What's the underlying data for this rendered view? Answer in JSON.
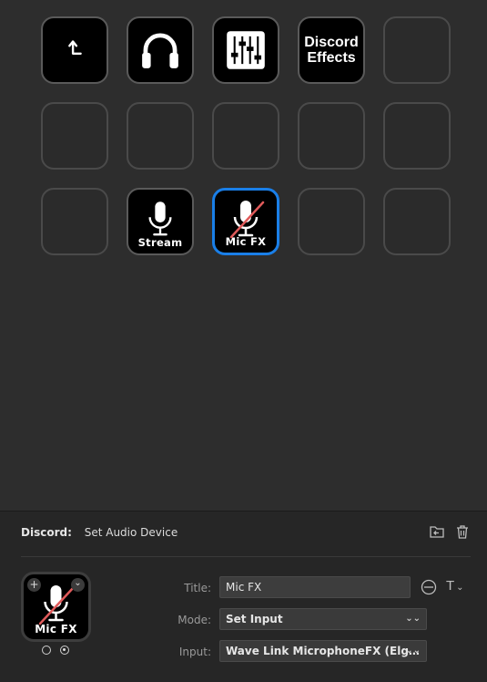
{
  "grid": {
    "keys": [
      {
        "id": "r1c1",
        "type": "back",
        "icon": "back-arrow-icon",
        "label": ""
      },
      {
        "id": "r1c2",
        "type": "icon",
        "icon": "headphones-icon",
        "label": ""
      },
      {
        "id": "r1c3",
        "type": "icon",
        "icon": "mixer-sliders-icon",
        "label": ""
      },
      {
        "id": "r1c4",
        "type": "text",
        "text_line1": "Discord",
        "text_line2": "Effects"
      },
      {
        "id": "r1c5",
        "type": "empty"
      },
      {
        "id": "r2c1",
        "type": "empty"
      },
      {
        "id": "r2c2",
        "type": "empty"
      },
      {
        "id": "r2c3",
        "type": "empty"
      },
      {
        "id": "r2c4",
        "type": "empty"
      },
      {
        "id": "r2c5",
        "type": "empty"
      },
      {
        "id": "r3c1",
        "type": "empty"
      },
      {
        "id": "r3c2",
        "type": "icon",
        "icon": "microphone-icon",
        "label": "Stream"
      },
      {
        "id": "r3c3",
        "type": "icon",
        "icon": "microphone-muted-icon",
        "label": "Mic FX",
        "selected": true
      },
      {
        "id": "r3c4",
        "type": "empty"
      },
      {
        "id": "r3c5",
        "type": "empty"
      }
    ]
  },
  "panel": {
    "plugin_name": "Discord:",
    "action_name": "Set Audio Device",
    "preview_label": "Mic FX",
    "title_label": "Title:",
    "title_value": "Mic FX",
    "mode_label": "Mode:",
    "mode_value": "Set Input",
    "input_label": "Input:",
    "input_value": "Wave Link MicrophoneFX (Elg…",
    "title_format_glyph": "T",
    "plus_glyph": "+",
    "caret_glyph": "⌄",
    "select_arrow_glyph": "⌄⌄"
  },
  "colors": {
    "accent": "#1a7fe8",
    "mute_slash": "#e05a5a"
  }
}
